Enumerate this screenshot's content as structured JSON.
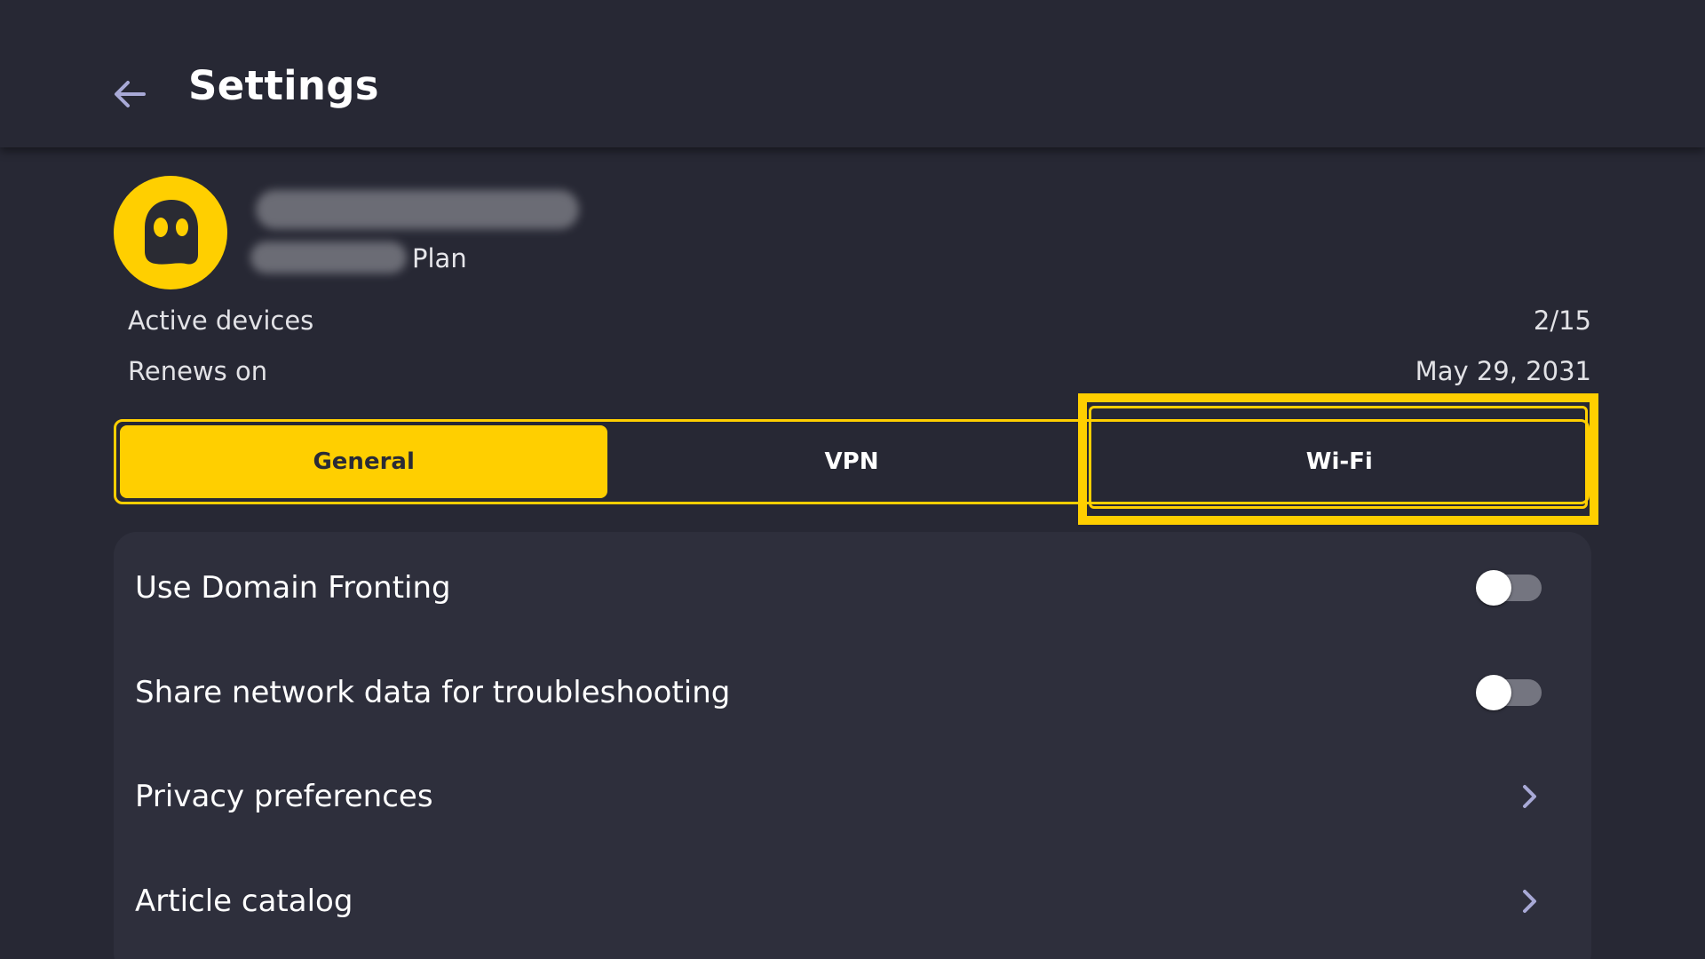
{
  "header": {
    "title": "Settings",
    "back_icon": "arrow-left-icon"
  },
  "account": {
    "avatar_icon": "ghost-logo-icon",
    "plan_suffix": "Plan",
    "active_devices_label": "Active devices",
    "active_devices_value": "2/15",
    "renews_label": "Renews on",
    "renews_value": "May 29, 2031"
  },
  "tabs": [
    {
      "label": "General",
      "state": "selected"
    },
    {
      "label": "VPN",
      "state": "default"
    },
    {
      "label": "Wi-Fi",
      "state": "focused"
    }
  ],
  "settings": [
    {
      "label": "Use Domain Fronting",
      "control": "toggle",
      "on": false
    },
    {
      "label": "Share network data for troubleshooting",
      "control": "toggle",
      "on": false
    },
    {
      "label": "Privacy preferences",
      "control": "chevron-right-icon"
    },
    {
      "label": "Article catalog",
      "control": "chevron-right-icon"
    }
  ],
  "colors": {
    "background": "#272834",
    "card": "#2e2f3c",
    "accent": "#ffcf00",
    "toggle_track": "#747580"
  }
}
